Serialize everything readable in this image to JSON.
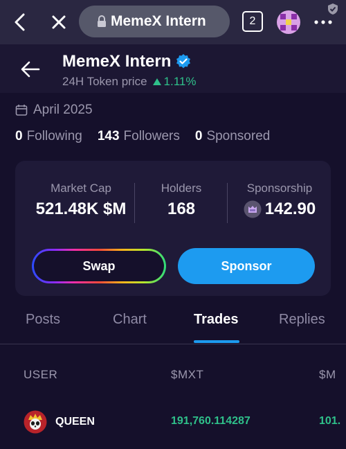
{
  "browser": {
    "url_title": "MemeX Intern",
    "tab_count": "2",
    "icons": [
      "back-icon",
      "close-icon",
      "lock-icon",
      "extension-avatar-icon",
      "more-icon",
      "shield-icon"
    ]
  },
  "profile": {
    "title": "MemeX Intern",
    "price_label": "24H Token price",
    "price_change": "1.11%",
    "date": "April 2025",
    "following_count": "0",
    "following_label": "Following",
    "followers_count": "143",
    "followers_label": "Followers",
    "sponsored_count": "0",
    "sponsored_label": "Sponsored"
  },
  "metrics": {
    "market_cap_label": "Market Cap",
    "market_cap_value": "521.48K $M",
    "holders_label": "Holders",
    "holders_value": "168",
    "sponsorship_label": "Sponsorship",
    "sponsorship_value": "142.90"
  },
  "actions": {
    "swap_label": "Swap",
    "sponsor_label": "Sponsor"
  },
  "tabs": [
    {
      "label": "Posts"
    },
    {
      "label": "Chart"
    },
    {
      "label": "Trades",
      "active": true
    },
    {
      "label": "Replies"
    }
  ],
  "trades": {
    "columns": [
      "USER",
      "$MXT",
      "$M"
    ],
    "rows": [
      {
        "user": "QUEEN",
        "mxt": "191,760.114287",
        "m": "101."
      }
    ]
  },
  "colors": {
    "accent": "#1d9bf0",
    "positive": "#2fc08a",
    "background": "#15102b"
  }
}
